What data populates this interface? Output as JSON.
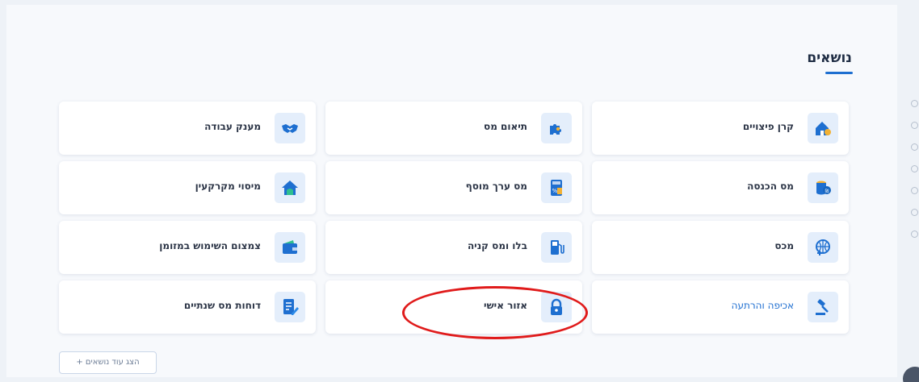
{
  "section": {
    "title": "נושאים"
  },
  "topics": [
    {
      "label": "קרן פיצויים",
      "icon": "house-coins-icon",
      "link": false
    },
    {
      "label": "תיאום מס",
      "icon": "puzzle-icon",
      "link": false
    },
    {
      "label": "מענק עבודה",
      "icon": "handshake-icon",
      "link": false
    },
    {
      "label": "מס הכנסה",
      "icon": "coins-stack-icon",
      "link": false
    },
    {
      "label": "מס ערך מוסף",
      "icon": "calculator-icon",
      "link": false
    },
    {
      "label": "מיסוי מקרקעין",
      "icon": "home-icon",
      "link": false
    },
    {
      "label": "מכס",
      "icon": "globe-plus-icon",
      "link": false
    },
    {
      "label": "בלו ומס קניה",
      "icon": "fuel-pump-icon",
      "link": false
    },
    {
      "label": "צמצום השימוש במזומן",
      "icon": "wallet-icon",
      "link": false
    },
    {
      "label": "אכיפה והרתעה",
      "icon": "gavel-icon",
      "link": true
    },
    {
      "label": "אזור אישי",
      "icon": "lock-icon",
      "link": false
    },
    {
      "label": "דוחות מס שנתיים",
      "icon": "document-edit-icon",
      "link": false
    }
  ],
  "more_button": {
    "label": "הצג עוד נושאים +"
  },
  "colors": {
    "accent": "#1e6fd0",
    "icon_bg": "#e4eefb",
    "highlight": "#e01b1b",
    "link": "#1f6fd1"
  }
}
